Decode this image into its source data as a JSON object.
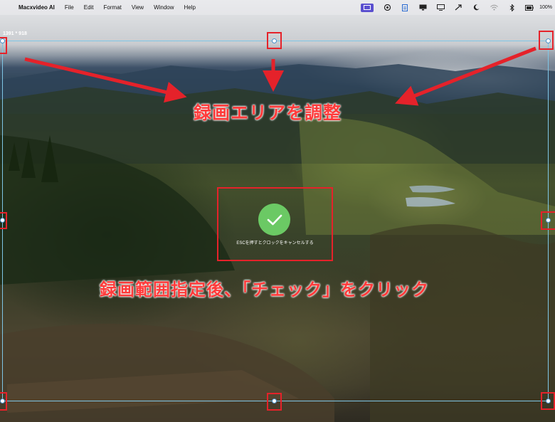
{
  "menubar": {
    "app_name": "Macxvideo AI",
    "menus": [
      "File",
      "Edit",
      "Format",
      "View",
      "Window",
      "Help"
    ],
    "apple_glyph": "",
    "status_icons": [
      "screen-record-icon",
      "cc-icon",
      "text-icon",
      "display-icon",
      "monitor-icon",
      "share-icon",
      "moon-icon",
      "wifi-icon",
      "bluetooth-icon",
      "battery-icon"
    ],
    "battery_percent": "100%",
    "accent_color": "#5a4fcf"
  },
  "capture": {
    "dimensions": "1391 * 918",
    "esc_hint": "ESCを押すとクロックをキャンセルする",
    "confirm_color": "#6bc964",
    "frame_color": "#7fc6e6"
  },
  "annotations": {
    "top": "録画エリアを調整",
    "bottom": "録画範囲指定後、「チェック」をクリック",
    "color": "#ff3b3b"
  }
}
